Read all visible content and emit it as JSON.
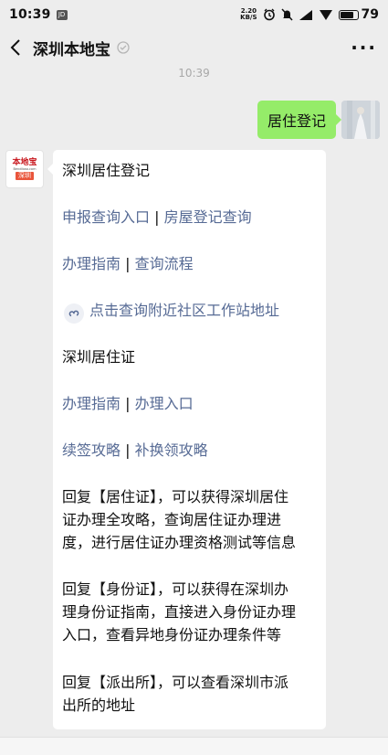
{
  "status_bar": {
    "time": "10:39",
    "jd_badge": "JD",
    "speed_value": "2.20",
    "speed_unit": "KB/S",
    "battery": "79",
    "battery_level_percent": 79
  },
  "nav": {
    "title": "深圳本地宝",
    "more_label": "···"
  },
  "timestamp": "10:39",
  "outgoing_message": "居住登记",
  "brand_avatar": {
    "top": "本地宝",
    "url": "Bendibao.com",
    "city": "深圳"
  },
  "reply": {
    "heading1": "深圳居住登记",
    "row1": {
      "a": "申报查询入口",
      "sep": " | ",
      "b": "房屋登记查询"
    },
    "row2": {
      "a": "办理指南",
      "sep": " | ",
      "b": "查询流程"
    },
    "miniapp_link": "点击查询附近社区工作站地址",
    "heading2": "深圳居住证",
    "row3": {
      "a": "办理指南",
      "sep": " | ",
      "b": "办理入口"
    },
    "row4": {
      "a": "续签攻略",
      "sep": " | ",
      "b": "补换领攻略"
    },
    "para1": {
      "line1": "回复【居住证】，可以获得深圳居住",
      "line2": "证办理全攻略，查询居住证办理进",
      "line3": "度，进行居住证办理资格测试等信息"
    },
    "para2": {
      "line1": "回复【身份证】，可以获得在深圳办",
      "line2": "理身份证指南，直接进入身份证办理",
      "line3": "入口，查看异地身份证办理条件等"
    },
    "para3": {
      "line1": "回复【派出所】，可以查看深圳市派",
      "line2": "出所的地址"
    }
  }
}
